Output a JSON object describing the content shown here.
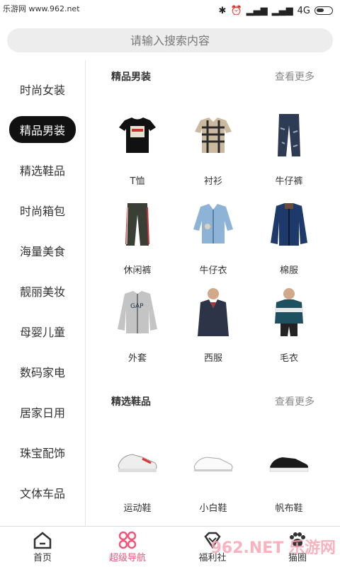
{
  "watermark_top": "乐游网 www.962.net",
  "status": {
    "network": "4G"
  },
  "search": {
    "placeholder": "请输入搜索内容"
  },
  "sidebar": {
    "items": [
      {
        "label": "时尚女装",
        "active": false
      },
      {
        "label": "精品男装",
        "active": true
      },
      {
        "label": "精选鞋品",
        "active": false
      },
      {
        "label": "时尚箱包",
        "active": false
      },
      {
        "label": "海量美食",
        "active": false
      },
      {
        "label": "靓丽美妆",
        "active": false
      },
      {
        "label": "母婴儿童",
        "active": false
      },
      {
        "label": "数码家电",
        "active": false
      },
      {
        "label": "居家日用",
        "active": false
      },
      {
        "label": "珠宝配饰",
        "active": false
      },
      {
        "label": "文体车品",
        "active": false
      }
    ]
  },
  "sections": [
    {
      "title": "精品男装",
      "more": "查看更多",
      "products": [
        "T恤",
        "衬衫",
        "牛仔裤",
        "休闲裤",
        "牛仔衣",
        "棉服",
        "外套",
        "西服",
        "毛衣"
      ]
    },
    {
      "title": "精选鞋品",
      "more": "查看更多",
      "products": [
        "运动鞋",
        "小白鞋",
        "帆布鞋"
      ]
    }
  ],
  "tabbar": {
    "items": [
      {
        "label": "首页",
        "icon": "home-icon"
      },
      {
        "label": "超级导航",
        "icon": "grid-icon",
        "active": true
      },
      {
        "label": "福利社",
        "icon": "diamond-icon"
      },
      {
        "label": "猫圈",
        "icon": "paw-icon"
      }
    ]
  },
  "colors": {
    "accent": "#f0557a",
    "active_bg": "#111111"
  },
  "watermark_bottom": "962.NET 乐游网"
}
